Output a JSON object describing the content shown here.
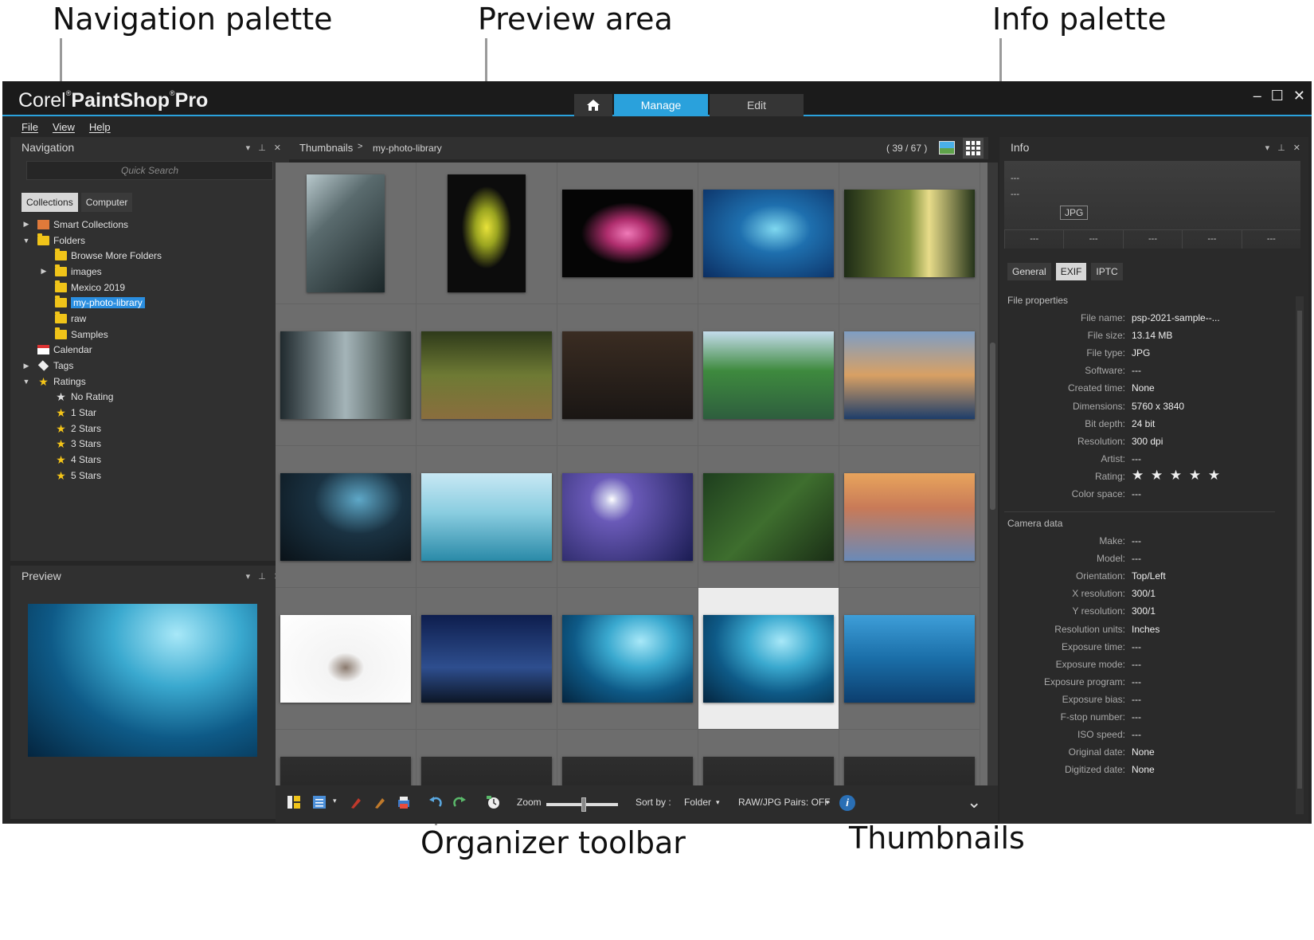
{
  "callouts": {
    "navigation": "Navigation palette",
    "preview": "Preview area",
    "info": "Info palette",
    "toolbar": "Organizer toolbar",
    "thumbnails": "Thumbnails"
  },
  "app": {
    "logo_a": "Corel",
    "logo_b": "PaintShop",
    "logo_c": "Pro",
    "reg": "®",
    "workspace_tabs": [
      "Manage",
      "Edit"
    ],
    "window_controls": [
      "–",
      "☐",
      "✕"
    ]
  },
  "menu": [
    "File",
    "View",
    "Help"
  ],
  "navigation": {
    "title": "Navigation",
    "panel_controls": [
      "▾",
      "⊥",
      "✕"
    ],
    "search_placeholder": "Quick Search",
    "tabs": [
      "Collections",
      "Computer"
    ],
    "tree": {
      "smart": "Smart Collections",
      "folders": "Folders",
      "browse": "Browse More Folders",
      "images": "images",
      "mexico": "Mexico 2019",
      "library": "my-photo-library",
      "raw": "raw",
      "samples": "Samples",
      "calendar": "Calendar",
      "tags": "Tags",
      "ratings": "Ratings",
      "no_rating": "No Rating",
      "s1": "1 Star",
      "s2": "2 Stars",
      "s3": "3 Stars",
      "s4": "4 Stars",
      "s5": "5 Stars"
    }
  },
  "preview": {
    "title": "Preview"
  },
  "breadcrumb": {
    "root": "Thumbnails",
    "separator": ">",
    "folder": "my-photo-library",
    "count": "( 39 / 67 )"
  },
  "toolbar": {
    "zoom_label": "Zoom",
    "sort_label": "Sort by :",
    "sort_value": "Folder",
    "raw_pairs": "RAW/JPG Pairs: OFF",
    "info_glyph": "i",
    "caret": "▾",
    "expand": "⌄"
  },
  "info": {
    "title": "Info",
    "preview_dashes": [
      "---",
      "---"
    ],
    "file_type_badge": "JPG",
    "columns": [
      "---",
      "---",
      "---",
      "---",
      "---"
    ],
    "tabs": [
      "General",
      "EXIF",
      "IPTC"
    ],
    "file_section": "File properties",
    "file_props": [
      {
        "k": "File name:",
        "v": "psp-2021-sample--..."
      },
      {
        "k": "File size:",
        "v": "13.14 MB"
      },
      {
        "k": "File type:",
        "v": "JPG"
      },
      {
        "k": "Software:",
        "v": "---"
      },
      {
        "k": "Created time:",
        "v": "None"
      },
      {
        "k": "Dimensions:",
        "v": "5760 x 3840"
      },
      {
        "k": "Bit depth:",
        "v": "24 bit"
      },
      {
        "k": "Resolution:",
        "v": "300 dpi"
      },
      {
        "k": "Artist:",
        "v": "---"
      },
      {
        "k": "Rating:",
        "v": "★ ★ ★ ★ ★"
      },
      {
        "k": "Color space:",
        "v": "---"
      }
    ],
    "camera_section": "Camera data",
    "camera_props": [
      {
        "k": "Make:",
        "v": "---"
      },
      {
        "k": "Model:",
        "v": "---"
      },
      {
        "k": "Orientation:",
        "v": "Top/Left"
      },
      {
        "k": "X resolution:",
        "v": "300/1"
      },
      {
        "k": "Y resolution:",
        "v": "300/1"
      },
      {
        "k": "Resolution units:",
        "v": "Inches"
      },
      {
        "k": "Exposure time:",
        "v": "---"
      },
      {
        "k": "Exposure mode:",
        "v": "---"
      },
      {
        "k": "Exposure program:",
        "v": "---"
      },
      {
        "k": "Exposure bias:",
        "v": "---"
      },
      {
        "k": "F-stop number:",
        "v": "---"
      },
      {
        "k": "ISO speed:",
        "v": "---"
      },
      {
        "k": "Original date:",
        "v": "None"
      },
      {
        "k": "Digitized date:",
        "v": "None"
      }
    ]
  },
  "colors": {
    "accent": "#2aa1dc",
    "selection": "#2a8ee0",
    "star": "#f5c518"
  },
  "thumbnails": [
    {
      "o": "p",
      "bg": "linear-gradient(135deg,#b8c8cc 0%,#5a6b6e 35%,#1b2628 100%)"
    },
    {
      "o": "p",
      "bg": "radial-gradient(ellipse at 50% 45%,#e8e23a 0%,#9aa420 20%,#0c0c0c 45%)"
    },
    {
      "o": "l",
      "bg": "radial-gradient(ellipse at 50% 50%,#f07ab8 0%,#b02e6e 22%,#050505 50%)"
    },
    {
      "o": "l",
      "bg": "radial-gradient(ellipse at 55% 45%,#7fd8f0 0%,#1e6fae 35%,#0b2e62 100%)"
    },
    {
      "o": "l",
      "bg": "linear-gradient(90deg,#1e2c16 0%,#7e8e3c 50%,#e8dc8a 65%,#25341a 100%)"
    },
    {
      "o": "l",
      "bg": "linear-gradient(90deg,#202a2e 0%,#a4b4b8 50%,#26302c 100%)"
    },
    {
      "o": "l",
      "bg": "linear-gradient(180deg,#2e3a1a 0%,#6e7a34 50%,#8a6e3e 100%)"
    },
    {
      "o": "l",
      "bg": "linear-gradient(180deg,#3a2c22 0%,#1a1614 100%)"
    },
    {
      "o": "l",
      "bg": "linear-gradient(180deg,#c4dcec 0%,#3e8a3e 45%,#2e5e3e 100%)"
    },
    {
      "o": "l",
      "bg": "linear-gradient(180deg,#7e9ec4 0%,#d8a064 50%,#1e3e6a 100%)"
    },
    {
      "o": "l",
      "bg": "radial-gradient(ellipse at 60% 30%,#5ea8c8 0%,#1a3242 40%,#0a1218 100%)"
    },
    {
      "o": "l",
      "bg": "linear-gradient(180deg,#c8e8f4 0%,#8acde0 45%,#2a8aa8 100%)"
    },
    {
      "o": "l",
      "bg": "radial-gradient(circle at 38% 30%,#ffffff 0%,#c8c8e8 6%,#6a5ab8 22%,#1a1c52 100%)"
    },
    {
      "o": "l",
      "bg": "linear-gradient(135deg,#1e3e1e 0%,#3e6e2e 50%,#1a2e16 100%)"
    },
    {
      "o": "l",
      "bg": "linear-gradient(180deg,#e8a45c 0%,#c87a58 40%,#6a8ab8 100%)"
    },
    {
      "o": "l",
      "bg": "radial-gradient(ellipse at 50% 60%,#8a7a6e 0%,#f4f4f4 20%,#ffffff 100%)"
    },
    {
      "o": "l",
      "bg": "linear-gradient(180deg,#0e1e4e 0%,#2e4e8e 60%,#0c1626 100%)"
    },
    {
      "o": "l",
      "bg": "radial-gradient(ellipse at 60% 30%,#a8e8f8 0%,#3aa9cf 30%,#0e5a87 60%,#04253f 100%)"
    },
    {
      "o": "l",
      "bg": "radial-gradient(ellipse at 60% 30%,#a8e8f8 0%,#3aa9cf 30%,#0e5a87 60%,#04253f 100%)",
      "selected": true
    },
    {
      "o": "l",
      "bg": "linear-gradient(180deg,#3e9ed8 0%,#1a6ea8 50%,#0c3e6e 100%)"
    },
    {
      "o": "l",
      "bg": "linear-gradient(180deg,#2e2e2e,#1e1e1e)"
    },
    {
      "o": "l",
      "bg": "linear-gradient(180deg,#2e2e2e,#1e1e1e)"
    },
    {
      "o": "l",
      "bg": "linear-gradient(180deg,#2e2e2e,#1e1e1e)"
    },
    {
      "o": "l",
      "bg": "linear-gradient(180deg,#2e2e2e,#1e1e1e)"
    },
    {
      "o": "l",
      "bg": "linear-gradient(180deg,#2e2e2e,#1e1e1e)"
    }
  ]
}
